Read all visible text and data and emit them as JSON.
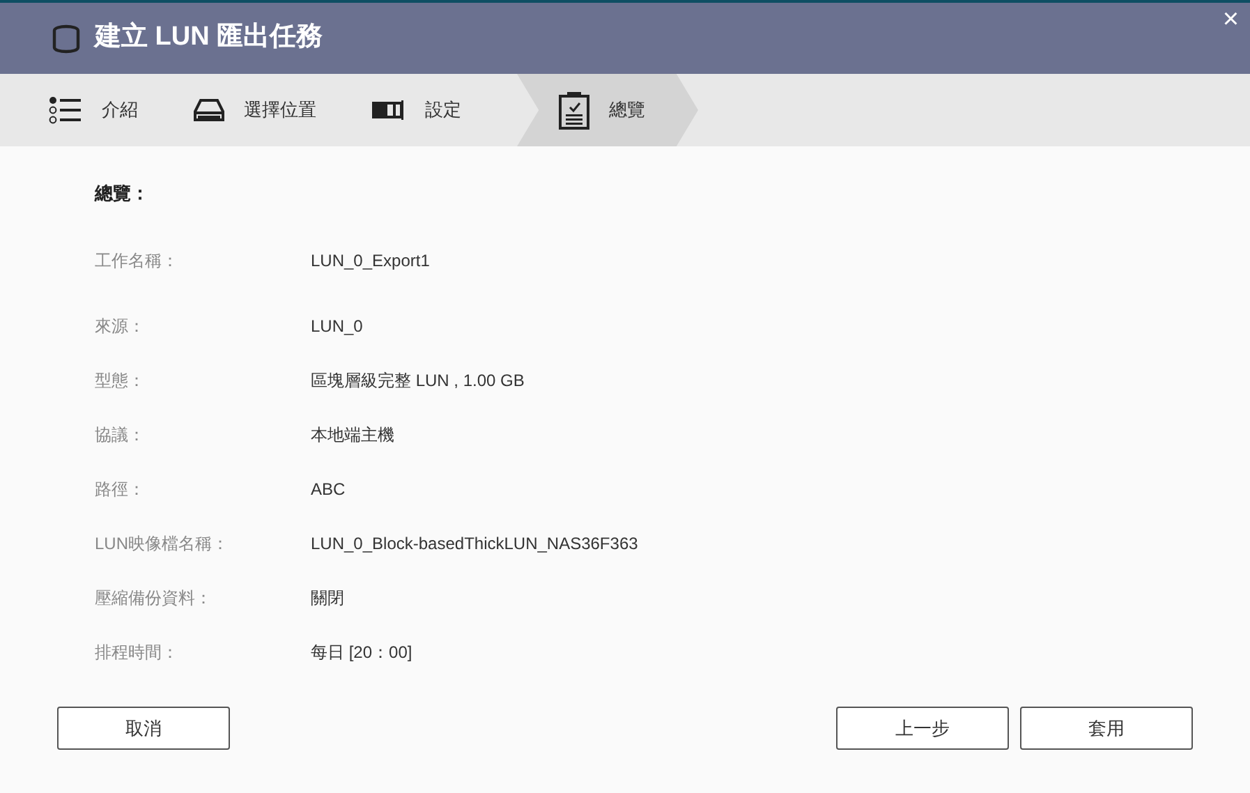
{
  "window": {
    "title": "建立 LUN 匯出任務",
    "close": "×"
  },
  "steps": [
    {
      "kind": "intro",
      "label": "介紹",
      "selected": false
    },
    {
      "kind": "location",
      "label": "選擇位置",
      "selected": false
    },
    {
      "kind": "settings",
      "label": "設定",
      "selected": false
    },
    {
      "kind": "summary",
      "label": "總覽",
      "selected": true
    }
  ],
  "summary": {
    "heading": "總覽：",
    "rows": [
      {
        "label": "工作名稱：",
        "value": "LUN_0_Export1"
      },
      {
        "label": "來源：",
        "value": "LUN_0"
      },
      {
        "label": "型態：",
        "value": "區塊層級完整 LUN , 1.00 GB"
      },
      {
        "label": "協議：",
        "value": "本地端主機"
      },
      {
        "label": "路徑：",
        "value": "ABC"
      },
      {
        "label": "LUN映像檔名稱：",
        "value": "LUN_0_Block-basedThickLUN_NAS36F363"
      },
      {
        "label": "壓縮備份資料：",
        "value": "關閉"
      },
      {
        "label": "排程時間：",
        "value": "每日 [20：00]"
      }
    ]
  },
  "buttons": {
    "cancel": "取消",
    "back": "上一步",
    "apply": "套用"
  }
}
